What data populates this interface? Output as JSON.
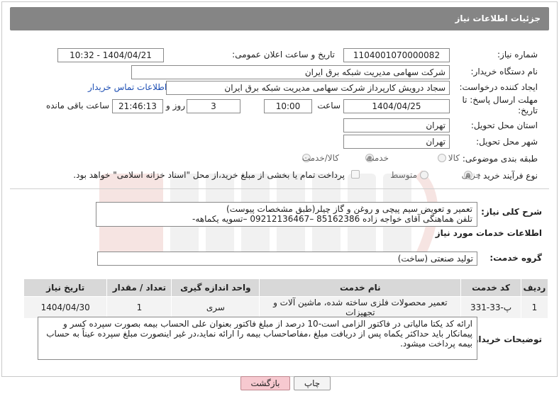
{
  "header": {
    "title": "جزئیات اطلاعات نیاز"
  },
  "form": {
    "need_number_label": "شماره نیاز:",
    "need_number": "1104001070000082",
    "announce_label": "تاریخ و ساعت اعلان عمومی:",
    "announce_value": "1404/04/21 - 10:32",
    "buyer_org_label": "نام دستگاه خریدار:",
    "buyer_org": "شرکت سهامی مدیریت شبکه برق ایران",
    "requester_label": "ایجاد کننده درخواست:",
    "requester": "سجاد درویش کارپرداز شرکت سهامی مدیریت شبکه برق ایران",
    "contact_link": "اطلاعات تماس خریدار",
    "deadline_label": "مهلت ارسال پاسخ: تا تاریخ:",
    "deadline_date": "1404/04/25",
    "time_label": "ساعت",
    "deadline_time": "10:00",
    "days_value": "3",
    "days_label": "روز و",
    "remaining_time": "21:46:13",
    "remaining_label": "ساعت باقی مانده",
    "province_label": "استان محل تحویل:",
    "province": "تهران",
    "city_label": "شهر محل تحویل:",
    "city": "تهران",
    "category_label": "طبقه بندی موضوعی:",
    "category_options": [
      "کالا",
      "خدمت",
      "کالا/خدمت"
    ],
    "category_selected": "خدمت",
    "process_label": "نوع فرآیند خرید :",
    "process_options": [
      "جزیی",
      "متوسط"
    ],
    "process_selected": "جزیی",
    "payment_note": "پرداخت تمام یا بخشی از مبلغ خرید،از محل \"اسناد خزانه اسلامی\" خواهد بود."
  },
  "summary": {
    "label": "شرح کلی نیاز:",
    "line1": "تعمیر و تعویض سیم پیچی و روغن و گاز چیلر(طبق مشخصات پیوست)",
    "line2": "تلفن هماهنگی آقای خواجه زاده 85162386 –09212136467 –تسویه یکماهه-"
  },
  "services": {
    "section_title": "اطلاعات خدمات مورد نیاز",
    "group_label": "گروه خدمت:",
    "group_value": "تولید صنعتی (ساخت)",
    "columns": [
      "ردیف",
      "کد خدمت",
      "نام خدمت",
      "واحد اندازه گیری",
      "تعداد / مقدار",
      "تاریخ نیاز"
    ],
    "rows": [
      [
        "1",
        "پ-33-331",
        "تعمیر محصولات فلزی ساخته شده، ماشین آلات و تجهیزات",
        "سری",
        "1",
        "1404/04/30"
      ]
    ]
  },
  "buyer_notes": {
    "label": "توضیحات خریدار:",
    "text": "ارائه کد یکتا مالیاتی در فاکتور الزامی است-10 درصد از مبلغ فاکتور بعنوان علی الحساب بیمه بصورت سپرده کسر و پیمانکار باید حداکثر یکماه پس از دریافت مبلغ ،مفاصاحساب بیمه را ارائه نماید،در غیر اینصورت مبلغ سپرده عیناً به حساب بیمه پرداخت میشود."
  },
  "buttons": {
    "print": "چاپ",
    "back": "بازگشت"
  },
  "colors": {
    "header_bg": "#858585",
    "link": "#1e4fb4",
    "back_button": "#f7c9d0"
  }
}
